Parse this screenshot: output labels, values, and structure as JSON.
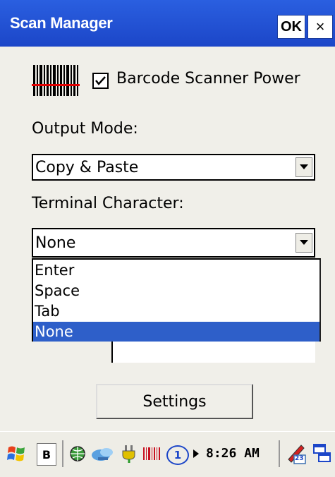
{
  "window": {
    "title": "Scan Manager",
    "ok_label": "OK",
    "close_label": "×"
  },
  "power": {
    "label": "Barcode Scanner Power",
    "checked": true
  },
  "output_mode": {
    "label": "Output Mode:",
    "value": "Copy & Paste"
  },
  "terminal_char": {
    "label": "Terminal Character:",
    "value": "None",
    "options": [
      "Enter",
      "Space",
      "Tab",
      "None"
    ],
    "selected": "None"
  },
  "settings_button": "Settings",
  "taskbar": {
    "start_icon": "windows-flag-icon",
    "input_label": "B",
    "clock": "8:26 AM",
    "calendar_day": "23",
    "battery_indicator": "1"
  },
  "colors": {
    "titlebar": "#1c46c8",
    "selection": "#2e5fc9"
  }
}
